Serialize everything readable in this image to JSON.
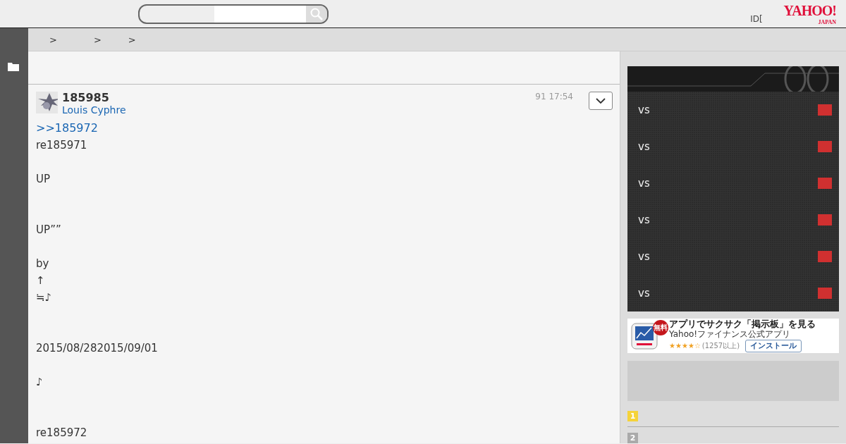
{
  "header": {
    "id_text": "ID[",
    "logo": {
      "main": "YAHOO!",
      "sub": "JAPAN"
    }
  },
  "breadcrumbs": [
    ">",
    ">",
    ">"
  ],
  "post": {
    "number": "185985",
    "author": "Louis Cyphre",
    "time": "91 17:54",
    "reply_link": ">>185972",
    "sections": [
      {
        "paragraphs": [
          [
            "re185971"
          ],
          [
            "UP"
          ]
        ]
      },
      {
        "paragraphs": [
          [
            "UP””"
          ],
          [
            "by",
            "↑",
            "≒♪"
          ]
        ]
      },
      {
        "paragraphs": [
          [
            "2015/08/282015/09/01"
          ],
          [
            "♪"
          ]
        ]
      },
      {
        "paragraphs": [
          [
            "re185972"
          ]
        ]
      }
    ]
  },
  "games": [
    {
      "label": "vs",
      "color": "#d03030"
    },
    {
      "label": "vs",
      "color": "#d03030"
    },
    {
      "label": "vs",
      "color": "#d03030"
    },
    {
      "label": "vs",
      "color": "#d03030"
    },
    {
      "label": "vs",
      "color": "#d03030"
    },
    {
      "label": "vs",
      "color": "#d03030"
    }
  ],
  "app_ad": {
    "badge": "無料",
    "title": "アプリでサクサク「掲示板」を見る",
    "subtitle": "Yahoo!ファイナンス公式アプリ",
    "stars": 4,
    "count": "(1257以上)",
    "button": "インストール"
  },
  "ranking": [
    {
      "rank": "1",
      "color": "#f5d33a"
    },
    {
      "rank": "2",
      "color": "#aaaaaa"
    }
  ]
}
